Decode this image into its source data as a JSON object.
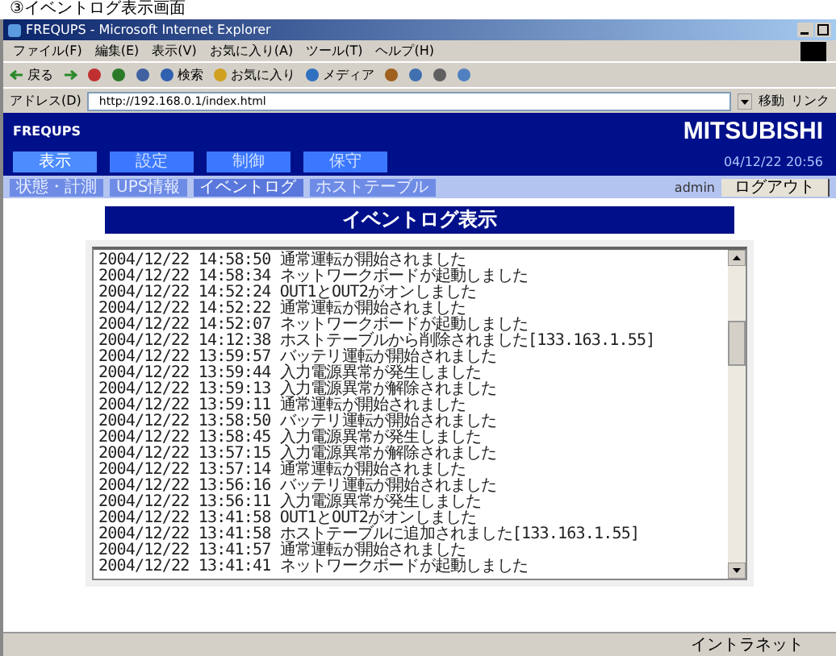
{
  "document_heading": "③イベントログ表示画面",
  "window": {
    "title": "FREQUPS - Microsoft Internet Explorer"
  },
  "menu_bar": [
    "ファイル(F)",
    "編集(E)",
    "表示(V)",
    "お気に入り(A)",
    "ツール(T)",
    "ヘルプ(H)"
  ],
  "toolbar": [
    {
      "kind": "back",
      "label": "戻る"
    },
    {
      "kind": "forward"
    },
    {
      "kind": "stop"
    },
    {
      "kind": "refresh"
    },
    {
      "kind": "home"
    },
    {
      "kind": "search",
      "label": "検索"
    },
    {
      "kind": "favorites",
      "label": "お気に入り"
    },
    {
      "kind": "media",
      "label": "メディア"
    },
    {
      "kind": "history"
    },
    {
      "kind": "mail"
    },
    {
      "kind": "print"
    },
    {
      "kind": "edit"
    }
  ],
  "address_bar": {
    "label": "アドレス(D)",
    "value": "http://192.168.0.1/index.html",
    "go": "移動",
    "links": "リンク"
  },
  "header": {
    "logo": "FREQUPS",
    "brand": "MITSUBISHI",
    "datetime": "04/12/22  20:56",
    "tabs": [
      {
        "label": "表示",
        "selected": true
      },
      {
        "label": "設定",
        "selected": false
      },
      {
        "label": "制御",
        "selected": false
      },
      {
        "label": "保守",
        "selected": false
      }
    ]
  },
  "subnav": {
    "tabs": [
      {
        "label": "状態・計測",
        "selected": false
      },
      {
        "label": "UPS情報",
        "selected": false
      },
      {
        "label": "イベントログ",
        "selected": true
      },
      {
        "label": "ホストテーブル",
        "selected": false
      }
    ],
    "user": "admin",
    "logout": "ログアウト"
  },
  "page_title": "イベントログ表示",
  "event_log": [
    "2004/12/22 14:58:50 通常運転が開始されました",
    "2004/12/22 14:58:34 ネットワークボードが起動しました",
    "2004/12/22 14:52:24 OUT1とOUT2がオンしました",
    "2004/12/22 14:52:22 通常運転が開始されました",
    "2004/12/22 14:52:07 ネットワークボードが起動しました",
    "2004/12/22 14:12:38 ホストテーブルから削除されました[133.163.1.55]",
    "2004/12/22 13:59:57 バッテリ運転が開始されました",
    "2004/12/22 13:59:44 入力電源異常が発生しました",
    "2004/12/22 13:59:13 入力電源異常が解除されました",
    "2004/12/22 13:59:11 通常運転が開始されました",
    "2004/12/22 13:58:50 バッテリ運転が開始されました",
    "2004/12/22 13:58:45 入力電源異常が発生しました",
    "2004/12/22 13:57:15 入力電源異常が解除されました",
    "2004/12/22 13:57:14 通常運転が開始されました",
    "2004/12/22 13:56:16 バッテリ運転が開始されました",
    "2004/12/22 13:56:11 入力電源異常が発生しました",
    "2004/12/22 13:41:58 OUT1とOUT2がオンしました",
    "2004/12/22 13:41:58 ホストテーブルに追加されました[133.163.1.55]",
    "2004/12/22 13:41:57 通常運転が開始されました",
    "2004/12/22 13:41:41 ネットワークボードが起動しました"
  ],
  "status_bar": {
    "zone": "イントラネット"
  }
}
